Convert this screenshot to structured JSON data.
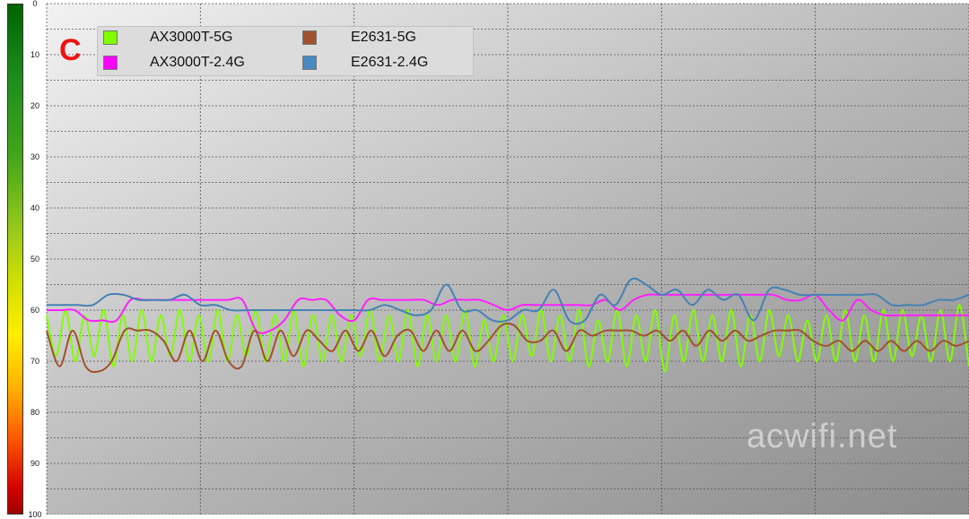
{
  "panel_letter": "C",
  "watermark": "acwifi.net",
  "chart_data": {
    "type": "line",
    "title": "",
    "xlabel": "",
    "ylabel": "",
    "ylim": [
      0,
      100
    ],
    "y_inverted": true,
    "y_ticks": [
      "0",
      "10",
      "20",
      "30",
      "40",
      "50",
      "60",
      "70",
      "80",
      "90",
      "100"
    ],
    "grid": true,
    "legend_position": "top-left",
    "series": [
      {
        "name": "AX3000T-5G",
        "color": "#80ff00",
        "legend_color": "#7fff00",
        "values": [
          61,
          69,
          60,
          70,
          61,
          69,
          60,
          71,
          61,
          70,
          60,
          70,
          61,
          69,
          60,
          70,
          61,
          70,
          60,
          70,
          61,
          69,
          60,
          70,
          61,
          70,
          60,
          71,
          61,
          70,
          61,
          70,
          61,
          69,
          60,
          70,
          61,
          70,
          60,
          71,
          61,
          70,
          61,
          70,
          60,
          71,
          62,
          70,
          61,
          70,
          61,
          69,
          60,
          70,
          61,
          70,
          60,
          71,
          62,
          70,
          60,
          71,
          61,
          70,
          60,
          72,
          61,
          70,
          60,
          70,
          61,
          70,
          60,
          71,
          61,
          70,
          60,
          69,
          61,
          70,
          62,
          70,
          61,
          70,
          60,
          70,
          61,
          70,
          60,
          70,
          60,
          69,
          61,
          70,
          60,
          70,
          59,
          71
        ]
      },
      {
        "name": "AX3000T-2.4G",
        "color": "#ff20ff",
        "legend_color": "#ff00ff",
        "values": [
          60,
          60,
          60,
          62,
          62,
          62,
          58,
          58,
          58,
          58,
          58,
          58,
          58,
          58,
          58,
          64,
          64,
          62,
          58,
          58,
          58,
          61,
          62,
          58,
          58,
          58,
          58,
          58,
          59,
          58,
          58,
          58,
          59,
          60,
          59,
          59,
          59,
          59,
          59,
          59,
          58,
          60,
          58,
          57,
          57,
          57,
          57,
          57,
          57,
          57,
          57,
          57,
          57,
          58,
          58,
          57,
          60,
          62,
          58,
          60,
          61,
          61,
          61,
          61,
          61,
          61,
          61
        ]
      },
      {
        "name": "E2631-5G",
        "color": "#a0522d",
        "legend_color": "#a0522d",
        "values": [
          64,
          71,
          64,
          71,
          72,
          70,
          64,
          64,
          64,
          66,
          70,
          64,
          70,
          64,
          70,
          71,
          64,
          70,
          64,
          69,
          64,
          66,
          68,
          64,
          68,
          64,
          69,
          65,
          64,
          68,
          64,
          68,
          64,
          68,
          66,
          63,
          63,
          66,
          66,
          64,
          68,
          64,
          65,
          64,
          64,
          64,
          65,
          64,
          66,
          64,
          67,
          64,
          66,
          64,
          66,
          65,
          64,
          64,
          64,
          66,
          67,
          66,
          68,
          66,
          68,
          66,
          68,
          66,
          68,
          66,
          67,
          66
        ]
      },
      {
        "name": "E2631-2.4G",
        "color": "#4682b4",
        "legend_color": "#4a8ac2",
        "values": [
          59,
          59,
          59,
          59,
          57,
          57,
          58,
          58,
          58,
          57,
          59,
          59,
          60,
          60,
          60,
          60,
          60,
          60,
          60,
          60,
          60,
          60,
          59,
          60,
          61,
          60,
          55,
          60,
          60,
          62,
          62,
          60,
          60,
          56,
          62,
          62,
          57,
          59,
          54,
          55,
          57,
          56,
          59,
          56,
          58,
          57,
          62,
          56,
          56,
          57,
          57,
          57,
          57,
          57,
          57,
          59,
          59,
          59,
          58,
          58,
          57
        ]
      }
    ]
  }
}
